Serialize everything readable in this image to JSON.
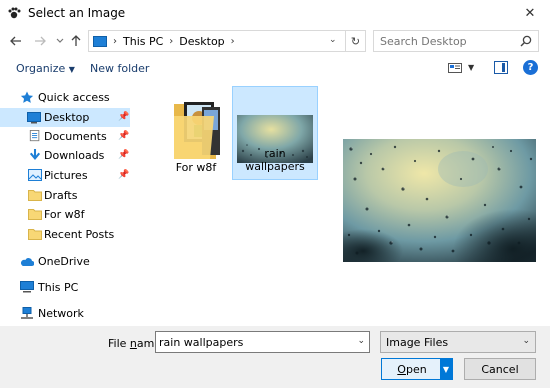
{
  "window": {
    "title": "Select an Image",
    "close_glyph": "✕"
  },
  "address": {
    "crumbs": [
      "This PC",
      "Desktop"
    ],
    "refresh_glyph": "↻"
  },
  "search": {
    "placeholder": "Search Desktop"
  },
  "toolbar": {
    "organize": "Organize",
    "new_folder": "New folder",
    "help": "?"
  },
  "nav": {
    "items": [
      {
        "label": "Quick access",
        "icon": "star-icon",
        "pinned": false
      },
      {
        "label": "Desktop",
        "icon": "desktop-icon",
        "pinned": true,
        "selected": true
      },
      {
        "label": "Documents",
        "icon": "documents-icon",
        "pinned": true
      },
      {
        "label": "Downloads",
        "icon": "download-arrow-icon",
        "pinned": true
      },
      {
        "label": "Pictures",
        "icon": "pictures-icon",
        "pinned": true
      },
      {
        "label": "Drafts",
        "icon": "folder-icon",
        "pinned": false
      },
      {
        "label": "For w8f",
        "icon": "folder-icon",
        "pinned": false
      },
      {
        "label": "Recent Posts",
        "icon": "folder-icon",
        "pinned": false
      },
      {
        "label": "OneDrive",
        "icon": "cloud-icon",
        "pinned": false
      },
      {
        "label": "This PC",
        "icon": "computer-icon",
        "pinned": false
      },
      {
        "label": "Network",
        "icon": "network-icon",
        "pinned": false
      }
    ]
  },
  "files": [
    {
      "label": "For w8f",
      "type": "folder"
    },
    {
      "label": "rain wallpapers",
      "type": "image",
      "selected": true
    }
  ],
  "bottom": {
    "file_name_label_pre": "File ",
    "file_name_label_u": "n",
    "file_name_label_post": "ame:",
    "file_name_value": "rain wallpapers",
    "filter_value": "Image Files",
    "open_u": "O",
    "open_rest": "pen",
    "cancel": "Cancel"
  },
  "colors": {
    "accent": "#0078d7",
    "selection": "#cce8ff",
    "folder": "#f8d775"
  }
}
